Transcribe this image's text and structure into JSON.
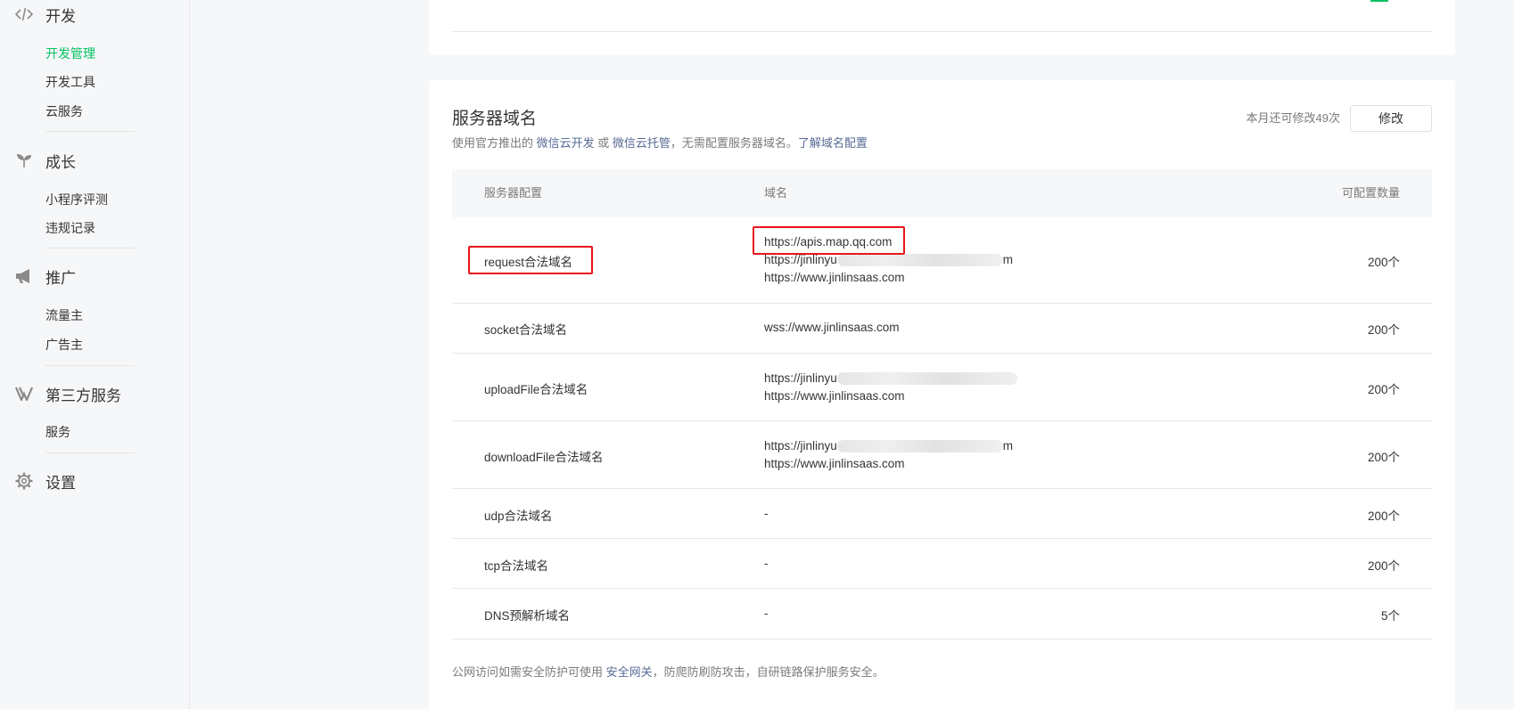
{
  "sidebar": {
    "groups": [
      {
        "label": "开发",
        "icon": "code-icon"
      },
      {
        "label": "成长",
        "icon": "sprout-icon"
      },
      {
        "label": "推广",
        "icon": "megaphone-icon"
      },
      {
        "label": "第三方服务",
        "icon": "third-party-icon"
      },
      {
        "label": "设置",
        "icon": "gear-icon"
      }
    ],
    "items": {
      "dev_manage": "开发管理",
      "dev_tools": "开发工具",
      "cloud": "云服务",
      "evaluate": "小程序评测",
      "violations": "违规记录",
      "traffic_owner": "流量主",
      "advertiser": "广告主",
      "service": "服务"
    },
    "active_color": "#07c160"
  },
  "domains_section": {
    "title": "服务器域名",
    "desc_prefix": "使用官方推出的 ",
    "desc_link1": "微信云开发",
    "desc_or": " 或 ",
    "desc_link2": "微信云托管",
    "desc_suffix": "，无需配置服务器域名。",
    "desc_link3": "了解域名配置",
    "quota_text": "本月还可修改49次",
    "edit_button": "修改",
    "table": {
      "headers": {
        "config": "服务器配置",
        "domain": "域名",
        "count": "可配置数量"
      },
      "rows": [
        {
          "name": "request合法域名",
          "domains": [
            "https://apis.map.qq.com",
            "https://jinlinyu",
            "https://www.jinlinsaas.com"
          ],
          "count": "200个"
        },
        {
          "name": "socket合法域名",
          "domains": [
            "wss://www.jinlinsaas.com"
          ],
          "count": "200个"
        },
        {
          "name": "uploadFile合法域名",
          "domains": [
            "https://jinlinyu",
            "https://www.jinlinsaas.com"
          ],
          "count": "200个"
        },
        {
          "name": "downloadFile合法域名",
          "domains": [
            "https://jinlinyu",
            "https://www.jinlinsaas.com"
          ],
          "count": "200个"
        },
        {
          "name": "udp合法域名",
          "domains": [
            "-"
          ],
          "count": "200个"
        },
        {
          "name": "tcp合法域名",
          "domains": [
            "-"
          ],
          "count": "200个"
        },
        {
          "name": "DNS预解析域名",
          "domains": [
            "-"
          ],
          "count": "5个"
        }
      ],
      "blurred_suffix": "m"
    },
    "footer_prefix": "公网访问如需安全防护可使用 ",
    "footer_link": "安全网关",
    "footer_suffix": "，防爬防刷防攻击，自研链路保护服务安全。"
  },
  "colors": {
    "link": "#576b95",
    "highlight": "#e8151b",
    "accent": "#07c160"
  }
}
